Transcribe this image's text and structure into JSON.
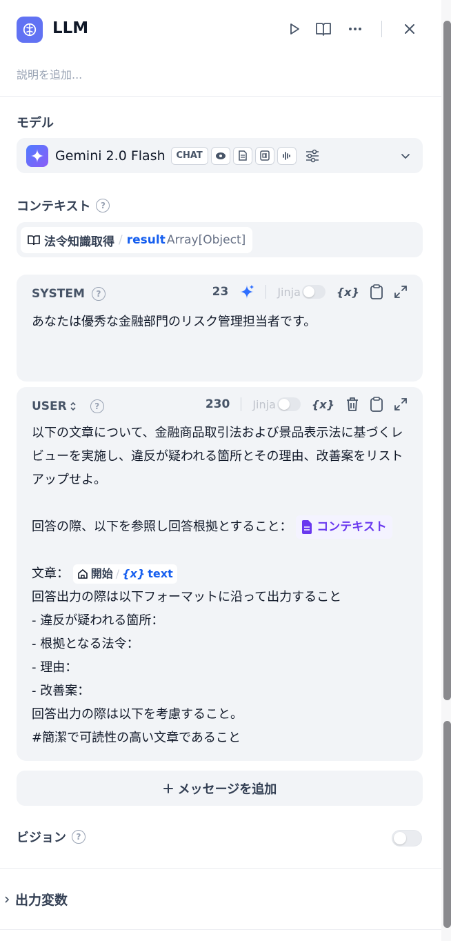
{
  "header": {
    "title": "LLM",
    "description_placeholder": "説明を追加..."
  },
  "model": {
    "label": "モデル",
    "name": "Gemini 2.0 Flash",
    "mode_badge": "CHAT",
    "capability_icons": [
      "eye-icon",
      "document-icon",
      "video-icon",
      "audio-icon"
    ]
  },
  "context": {
    "label": "コンテキスト",
    "source_node": "法令知識取得",
    "separator": "/",
    "variable": "result",
    "type": "Array[Object]"
  },
  "system": {
    "role": "SYSTEM",
    "count": "23",
    "jinja_label": "Jinja",
    "text": "あなたは優秀な金融部門のリスク管理担当者です。"
  },
  "user": {
    "role": "USER",
    "count": "230",
    "jinja_label": "Jinja",
    "line1": "以下の文章について、金融商品取引法および景品表示法に基づくレビューを実施し、違反が疑われる箇所とその理由、改善案をリストアップせよ。",
    "line2": "回答の際、以下を参照し回答根拠とすること：",
    "context_chip": "コンテキスト",
    "line3_prefix": "文章：",
    "start_node": "開始",
    "start_sep": "/",
    "start_var": "text",
    "rest": [
      "回答出力の際は以下フォーマットに沿って出力すること",
      "- 違反が疑われる箇所：",
      "- 根拠となる法令：",
      "- 理由：",
      "- 改善案：",
      "回答出力の際は以下を考慮すること。",
      "#簡潔で可読性の高い文章であること"
    ]
  },
  "add_message_label": "メッセージを追加",
  "vision": {
    "label": "ビジョン",
    "enabled": false
  },
  "output_vars_label": "出力変数",
  "colors": {
    "accent": "#6172f3",
    "variable_blue": "#155eef",
    "context_purple": "#6938ef",
    "panel_bg": "#f2f4f7"
  }
}
